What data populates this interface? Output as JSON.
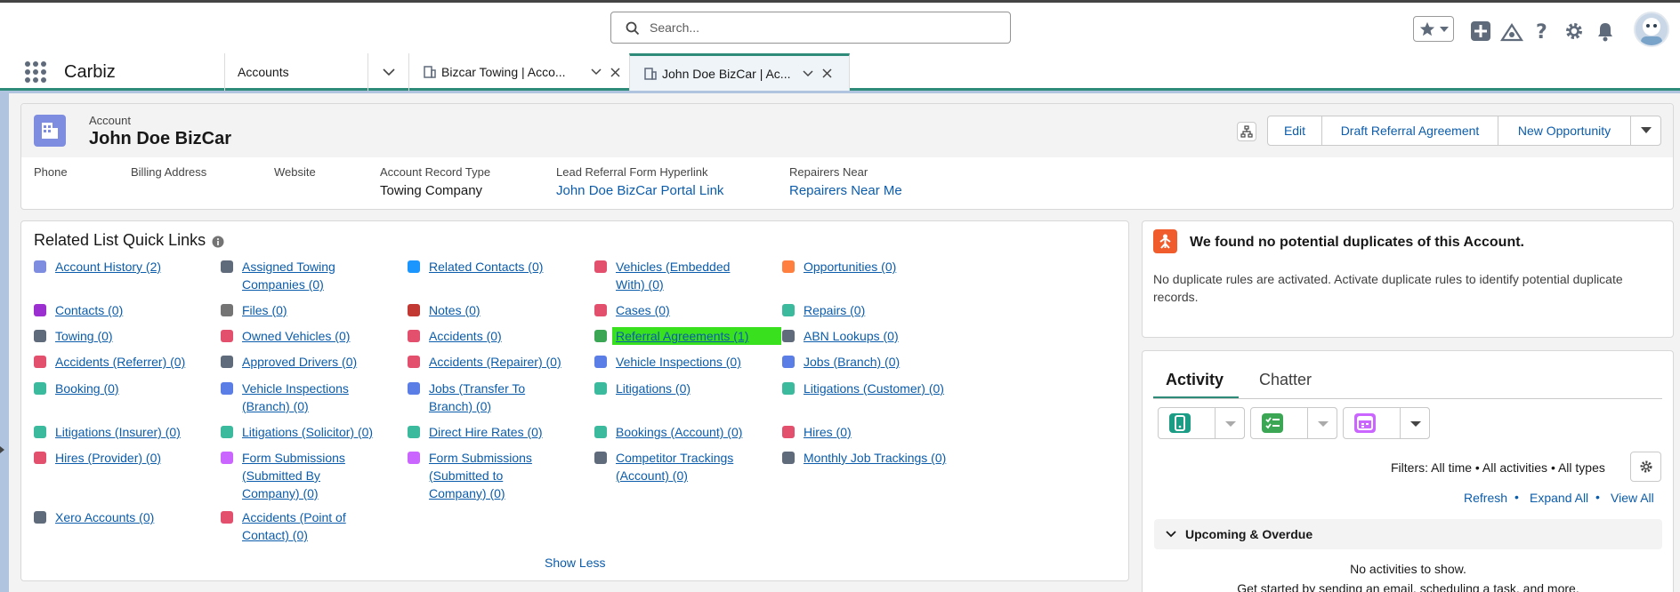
{
  "topbar": {
    "search_placeholder": "Search...",
    "icons": [
      "favorites-star-icon",
      "add-icon",
      "trailhead-icon",
      "help-icon",
      "setup-gear-icon",
      "notifications-bell-icon",
      "user-avatar"
    ]
  },
  "nav": {
    "app_name": "Carbiz",
    "object_tab": "Accounts",
    "tabs": [
      {
        "label": "Bizcar Towing | Acco..."
      },
      {
        "label": "John Doe BizCar | Ac..."
      }
    ]
  },
  "record": {
    "object_label": "Account",
    "name": "John Doe BizCar",
    "buttons": {
      "edit": "Edit",
      "draft": "Draft Referral Agreement",
      "new_opp": "New Opportunity"
    },
    "fields": [
      {
        "label": "Phone",
        "value": ""
      },
      {
        "label": "Billing Address",
        "value": ""
      },
      {
        "label": "Website",
        "value": ""
      },
      {
        "label": "Account Record Type",
        "value": "Towing Company"
      },
      {
        "label": "Lead Referral Form Hyperlink",
        "value": "John Doe BizCar Portal Link"
      },
      {
        "label": "Repairers Near",
        "value": "Repairers Near Me"
      }
    ]
  },
  "related": {
    "title": "Related List Quick Links",
    "show_less": "Show Less",
    "links": [
      "Account History (2)",
      "Assigned Towing Companies (0)",
      "Related Contacts (0)",
      "Vehicles (Embedded With) (0)",
      "Opportunities (0)",
      "Contacts (0)",
      "Files (0)",
      "Notes (0)",
      "Cases (0)",
      "Repairs (0)",
      "Towing (0)",
      "Owned Vehicles (0)",
      "Accidents (0)",
      "Referral Agreements (1)",
      "ABN Lookups (0)",
      "Accidents (Referrer) (0)",
      "Approved Drivers (0)",
      "Accidents (Repairer) (0)",
      "Vehicle Inspections (0)",
      "Jobs (Branch) (0)",
      "Booking (0)",
      "Vehicle Inspections (Branch) (0)",
      "Jobs (Transfer To Branch) (0)",
      "Litigations (0)",
      "Litigations (Customer) (0)",
      "Litigations (Insurer) (0)",
      "Litigations (Solicitor) (0)",
      "Direct Hire Rates (0)",
      "Bookings (Account) (0)",
      "Hires (0)",
      "Hires (Provider) (0)",
      "Form Submissions (Submitted By Company) (0)",
      "Form Submissions (Submitted to Company) (0)",
      "Competitor Trackings (Account) (0)",
      "Monthly Job Trackings (0)",
      "Xero Accounts (0)",
      "Accidents (Point of Contact) (0)"
    ]
  },
  "duplicates": {
    "title": "We found no potential duplicates of this Account.",
    "body": "No duplicate rules are activated. Activate duplicate rules to identify potential duplicate records."
  },
  "activity": {
    "tab_activity": "Activity",
    "tab_chatter": "Chatter",
    "filters": "Filters: All time • All activities • All types",
    "refresh": "Refresh",
    "expand_all": "Expand All",
    "view_all": "View All",
    "section": "Upcoming & Overdue",
    "empty": "No activities to show.",
    "empty_sub": "Get started by sending an email, scheduling a task, and more."
  },
  "colors": {
    "brand_link": "#0b5cab",
    "nav_accent": "#2e8b79",
    "highlight": "#39e01e",
    "dup_icon": "#f05c2c"
  }
}
